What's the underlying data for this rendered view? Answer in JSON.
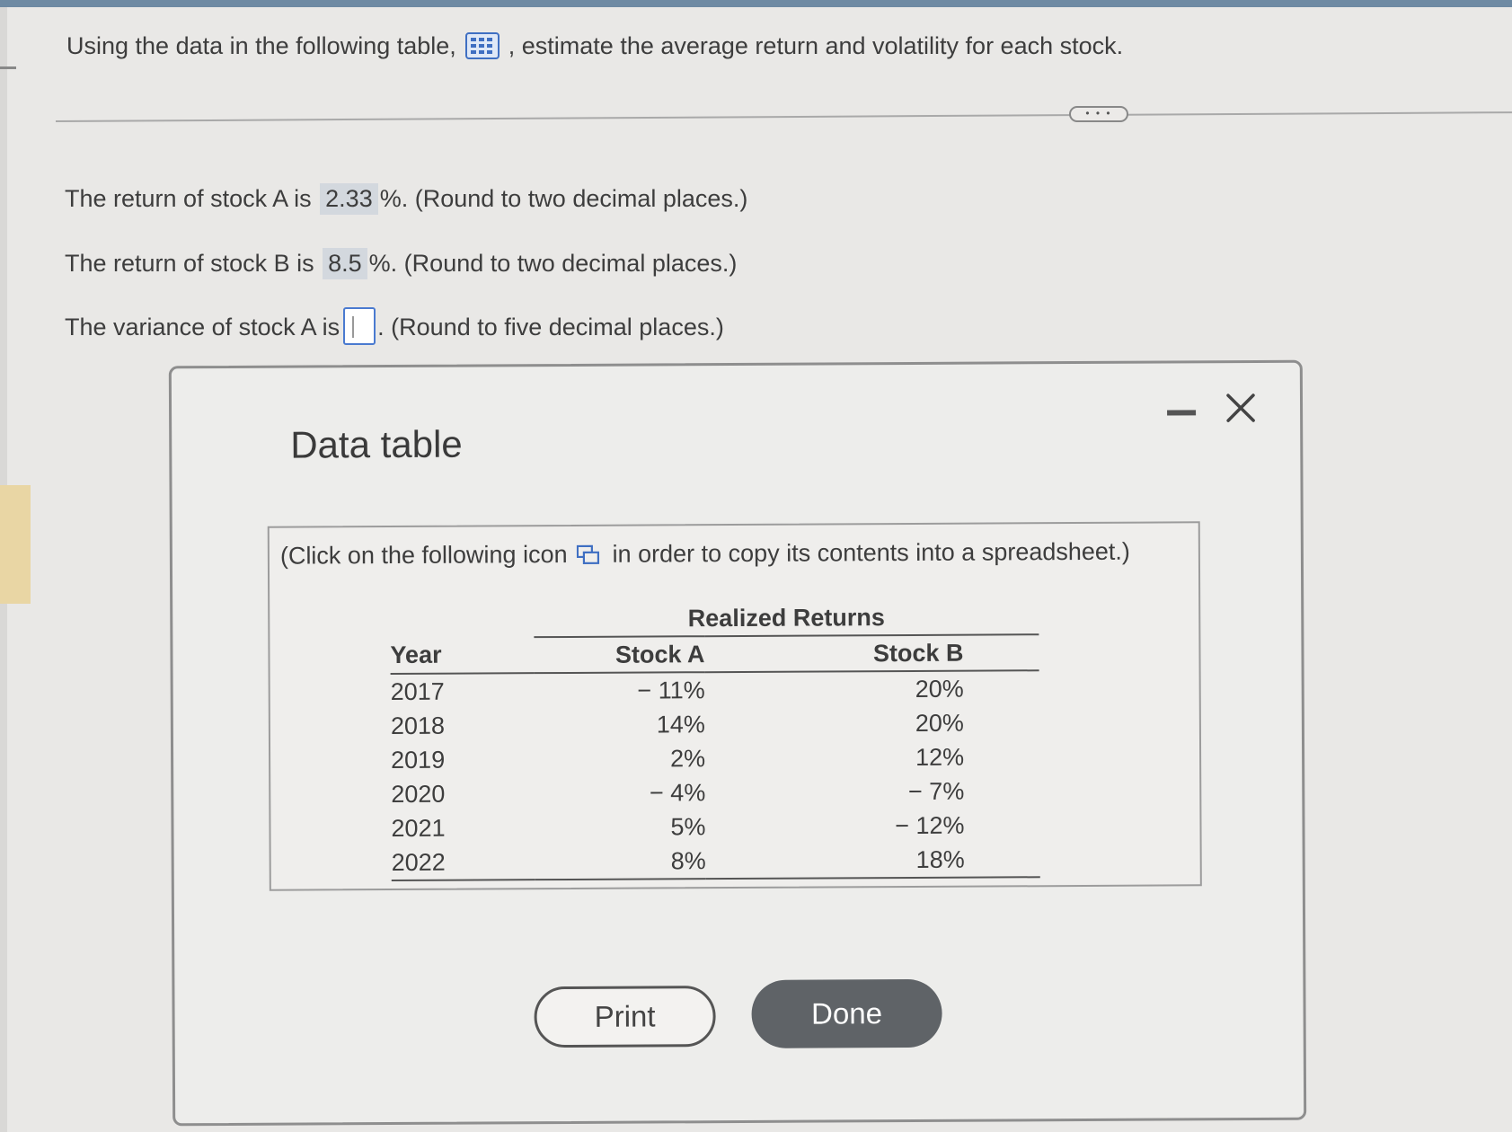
{
  "question": {
    "prefix": "Using the data in the following table,",
    "suffix": ", estimate the average return and volatility for each stock."
  },
  "more_label": "• • •",
  "answers": {
    "stock_a": {
      "prefix": "The return of stock A is",
      "value": "2.33",
      "suffix": "%.  (Round to two decimal places.)"
    },
    "stock_b": {
      "prefix": "The return of stock B is",
      "value": "8.5",
      "suffix": "%.  (Round to two decimal places.)"
    },
    "variance_a": {
      "prefix": "The variance of stock A is",
      "value": "",
      "suffix": ".  (Round to five decimal places.)"
    }
  },
  "dialog": {
    "title": "Data table",
    "copy_note_prefix": "(Click on the following icon",
    "copy_note_suffix": "in order to copy its contents into a spreadsheet.)",
    "table": {
      "group_header": "Realized Returns",
      "headers": {
        "year": "Year",
        "stock_a": "Stock A",
        "stock_b": "Stock B"
      },
      "rows": [
        {
          "year": "2017",
          "stock_a": "− 11%",
          "stock_b": "20%"
        },
        {
          "year": "2018",
          "stock_a": "14%",
          "stock_b": "20%"
        },
        {
          "year": "2019",
          "stock_a": "2%",
          "stock_b": "12%"
        },
        {
          "year": "2020",
          "stock_a": "− 4%",
          "stock_b": "− 7%"
        },
        {
          "year": "2021",
          "stock_a": "5%",
          "stock_b": "− 12%"
        },
        {
          "year": "2022",
          "stock_a": "8%",
          "stock_b": "18%"
        }
      ]
    },
    "buttons": {
      "print": "Print",
      "done": "Done"
    }
  },
  "colors": {
    "accent_blue": "#3f6fc2",
    "done_button": "#5f6367",
    "answer_highlight": "#d3d8de"
  },
  "icons": [
    "table-grid-icon",
    "copy-icon",
    "minimize-icon",
    "close-icon",
    "mouse-cursor-icon"
  ]
}
